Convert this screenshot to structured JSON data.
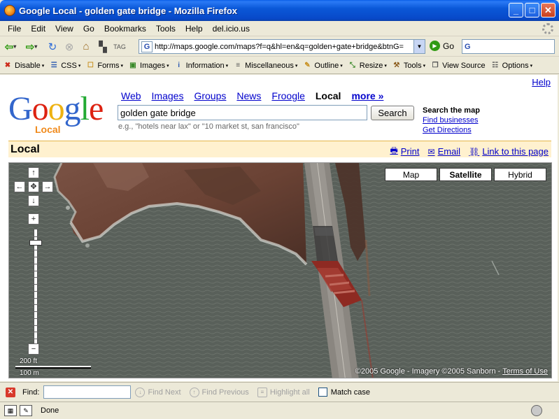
{
  "window": {
    "title": "Google Local - golden gate bridge - Mozilla Firefox",
    "minimize": "_",
    "maximize": "□",
    "close": "✕"
  },
  "menu": [
    "File",
    "Edit",
    "View",
    "Go",
    "Bookmarks",
    "Tools",
    "Help",
    "del.icio.us"
  ],
  "nav": {
    "url": "http://maps.google.com/maps?f=q&hl=en&q=golden+gate+bridge&btnG=",
    "go_label": "Go",
    "search_engine_icon": "G"
  },
  "devtoolbar": [
    {
      "label": "Disable",
      "icon": "disable-icon",
      "glyph": "✖",
      "color": "#cc2a1a",
      "dropdown": true
    },
    {
      "label": "CSS",
      "icon": "css-icon",
      "glyph": "☰",
      "color": "#2a58b0",
      "dropdown": true
    },
    {
      "label": "Forms",
      "icon": "forms-icon",
      "glyph": "☐",
      "color": "#c89020",
      "dropdown": true
    },
    {
      "label": "Images",
      "icon": "images-icon",
      "glyph": "▣",
      "color": "#3b8a2a",
      "dropdown": true
    },
    {
      "label": "Information",
      "icon": "information-icon",
      "glyph": "i",
      "color": "#2a58b0",
      "dropdown": true
    },
    {
      "label": "Miscellaneous",
      "icon": "miscellaneous-icon",
      "glyph": "≡",
      "color": "#555555",
      "dropdown": true
    },
    {
      "label": "Outline",
      "icon": "outline-icon",
      "glyph": "✎",
      "color": "#c89020",
      "dropdown": true
    },
    {
      "label": "Resize",
      "icon": "resize-icon",
      "glyph": "⤡",
      "color": "#3b8a2a",
      "dropdown": true
    },
    {
      "label": "Tools",
      "icon": "tools-icon",
      "glyph": "⚒",
      "color": "#8a5a1a",
      "dropdown": true
    },
    {
      "label": "View Source",
      "icon": "view-source-icon",
      "glyph": "❐",
      "color": "#555555",
      "dropdown": false
    },
    {
      "label": "Options",
      "icon": "options-icon",
      "glyph": "☷",
      "color": "#555555",
      "dropdown": true
    }
  ],
  "page": {
    "help": "Help",
    "logo": {
      "word": "Google",
      "sub": "Local"
    },
    "tabs": [
      {
        "label": "Web",
        "active": false
      },
      {
        "label": "Images",
        "active": false
      },
      {
        "label": "Groups",
        "active": false
      },
      {
        "label": "News",
        "active": false
      },
      {
        "label": "Froogle",
        "active": false
      },
      {
        "label": "Local",
        "active": true
      },
      {
        "label": "more »",
        "active": false,
        "more": true
      }
    ],
    "query": "golden gate bridge",
    "search_button": "Search",
    "hint": "e.g., \"hotels near lax\" or \"10 market st, san francisco\"",
    "side": {
      "heading": "Search the map",
      "find_businesses": "Find businesses",
      "get_directions": "Get Directions"
    },
    "local_bar": {
      "title": "Local",
      "print": "Print",
      "email": "Email",
      "link": "Link to this page"
    },
    "map": {
      "types": [
        {
          "label": "Map",
          "active": false
        },
        {
          "label": "Satellite",
          "active": true
        },
        {
          "label": "Hybrid",
          "active": false
        }
      ],
      "pan": {
        "up": "↑",
        "down": "↓",
        "left": "←",
        "right": "→",
        "center": "✥"
      },
      "zoom": {
        "in": "+",
        "out": "−",
        "level_fraction": 0.9
      },
      "scale": {
        "feet": "200 ft",
        "meters": "100 m"
      },
      "attribution": "©2005 Google - Imagery ©2005 Sanborn - ",
      "terms": "Terms of Use"
    }
  },
  "findbar": {
    "label": "Find:",
    "value": "",
    "find_next": "Find Next",
    "find_previous": "Find Previous",
    "highlight_all": "Highlight all",
    "match_case": "Match case"
  },
  "status": {
    "text": "Done"
  },
  "colors": {
    "google_blue": "#3366cc",
    "google_red": "#dd2211",
    "google_yellow": "#eeb211",
    "google_green": "#22aa33",
    "local_orange": "#f08a1c",
    "link": "#0000cc",
    "local_bar_bg": "#fff1cf"
  }
}
